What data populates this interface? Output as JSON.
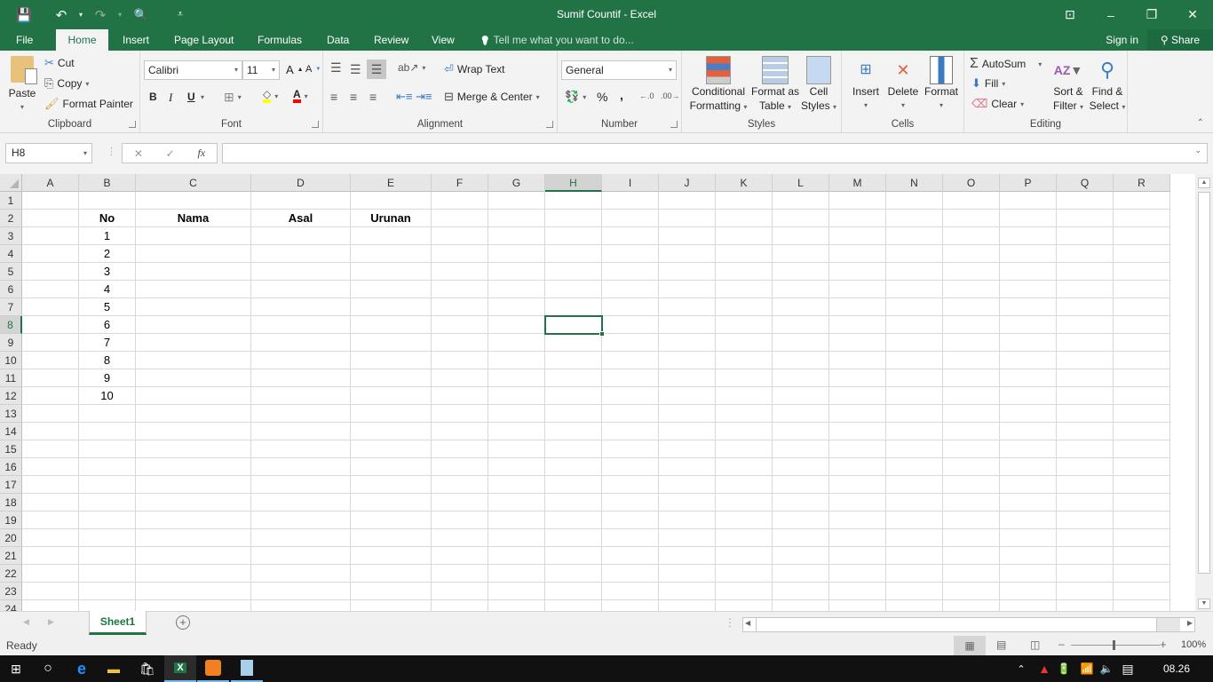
{
  "window": {
    "title": "Sumif Countif - Excel",
    "controls": {
      "ribbon_display": "⊡",
      "minimize": "–",
      "restore": "❐",
      "close": "✕"
    }
  },
  "qat": {
    "save": "💾",
    "undo": "↶",
    "redo": "↷",
    "print_preview": "🔍",
    "customize": "⩡"
  },
  "tabs": [
    {
      "label": "File"
    },
    {
      "label": "Home"
    },
    {
      "label": "Insert"
    },
    {
      "label": "Page Layout"
    },
    {
      "label": "Formulas"
    },
    {
      "label": "Data"
    },
    {
      "label": "Review"
    },
    {
      "label": "View"
    }
  ],
  "tellme": {
    "icon": "💡",
    "placeholder": "Tell me what you want to do..."
  },
  "account": {
    "signin": "Sign in",
    "share": "Share"
  },
  "ribbon": {
    "clipboard": {
      "label": "Clipboard",
      "paste": "Paste",
      "cut": "Cut",
      "copy": "Copy",
      "format_painter": "Format Painter"
    },
    "font": {
      "label": "Font",
      "family": "Calibri",
      "size": "11",
      "bold": "B",
      "italic": "I",
      "underline": "U",
      "grow": "A",
      "shrink": "A",
      "fill_color": "#ffff00",
      "font_color": "#ff0000"
    },
    "alignment": {
      "label": "Alignment",
      "wrap_text": "Wrap Text",
      "merge_center": "Merge & Center"
    },
    "number": {
      "label": "Number",
      "format": "General",
      "percent": "%",
      "comma": ",",
      "inc_dec": "←.0",
      "dec_dec": ".00→"
    },
    "styles": {
      "label": "Styles",
      "conditional_1": "Conditional",
      "conditional_2": "Formatting",
      "format_table_1": "Format as",
      "format_table_2": "Table",
      "cell_styles_1": "Cell",
      "cell_styles_2": "Styles"
    },
    "cells": {
      "label": "Cells",
      "insert": "Insert",
      "delete": "Delete",
      "format": "Format"
    },
    "editing": {
      "label": "Editing",
      "autosum": "AutoSum",
      "fill": "Fill",
      "clear": "Clear",
      "sort_1": "Sort &",
      "sort_2": "Filter",
      "find_1": "Find &",
      "find_2": "Select"
    }
  },
  "formula_bar": {
    "name_box": "H8",
    "cancel": "✕",
    "enter": "✓",
    "fx": "fx",
    "formula": ""
  },
  "sheet": {
    "columns": [
      "A",
      "B",
      "C",
      "D",
      "E",
      "F",
      "G",
      "H",
      "I",
      "J",
      "K",
      "L",
      "M",
      "N",
      "O",
      "P",
      "Q",
      "R"
    ],
    "selected_column": "H",
    "rows": [
      "1",
      "2",
      "3",
      "4",
      "5",
      "6",
      "7",
      "8",
      "9",
      "10",
      "11",
      "12",
      "13",
      "14",
      "15",
      "16",
      "17",
      "18",
      "19",
      "20",
      "21",
      "22",
      "23",
      "24"
    ],
    "selected_row": "8",
    "selected_cell": "H8",
    "headers": {
      "B2": "No",
      "C2": "Nama",
      "D2": "Asal",
      "E2": "Urunan"
    },
    "no_values": [
      "1",
      "2",
      "3",
      "4",
      "5",
      "6",
      "7",
      "8",
      "9",
      "10"
    ]
  },
  "sheet_tabs": [
    {
      "label": "Sheet1",
      "active": true
    }
  ],
  "status": {
    "text": "Ready",
    "zoom": "100%",
    "zoom_level_percent": 100
  },
  "taskbar": {
    "time": "08.26"
  }
}
